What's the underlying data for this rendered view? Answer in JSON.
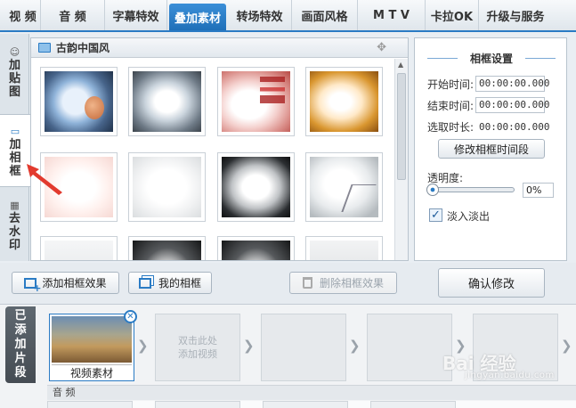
{
  "top_tabs": [
    {
      "label": "视  频",
      "active": false
    },
    {
      "label": "音  频",
      "active": false
    },
    {
      "label": "字幕特效",
      "active": false
    },
    {
      "label": "叠加素材",
      "active": true
    },
    {
      "label": "转场特效",
      "active": false
    },
    {
      "label": "画面风格",
      "active": false
    },
    {
      "label": "M T V",
      "active": false
    },
    {
      "label": "卡拉OK",
      "active": false
    },
    {
      "label": "升级与服务",
      "active": false
    }
  ],
  "left_tabs": [
    {
      "label": "加贴图",
      "icon": "smiley-icon",
      "active": false
    },
    {
      "label": "加相框",
      "icon": "frame-add-icon",
      "active": true
    },
    {
      "label": "去水印",
      "icon": "mosaic-icon",
      "active": false
    }
  ],
  "frames_panel": {
    "title": "古韵中国风",
    "icon": "image-icon",
    "move_icon": "✥"
  },
  "settings": {
    "title": "相框设置",
    "start_label": "开始时间:",
    "start_value": "00:00:00.000",
    "end_label": "结束时间:",
    "end_value": "00:00:00.000",
    "duration_label": "选取时长:",
    "duration_value": "00:00:00.000",
    "modify_segment_label": "修改相框时间段",
    "opacity_label": "透明度:",
    "opacity_value": "0%",
    "opacity_level": 0,
    "fade_label": "淡入淡出",
    "fade_checked": true,
    "confirm_label": "确认修改"
  },
  "actions": {
    "add_frame_label": "添加相框效果",
    "my_frames_label": "我的相框",
    "delete_frame_label": "删除相框效果"
  },
  "timeline": {
    "added_label": "已添加片段",
    "first_clip_label": "视频素材",
    "add_hint_line1": "双击此处",
    "add_hint_line2": "添加视频",
    "audio_label": "音 频"
  },
  "watermark": {
    "text": "Bai 经验",
    "sub": "jingyan.baidu.com"
  }
}
